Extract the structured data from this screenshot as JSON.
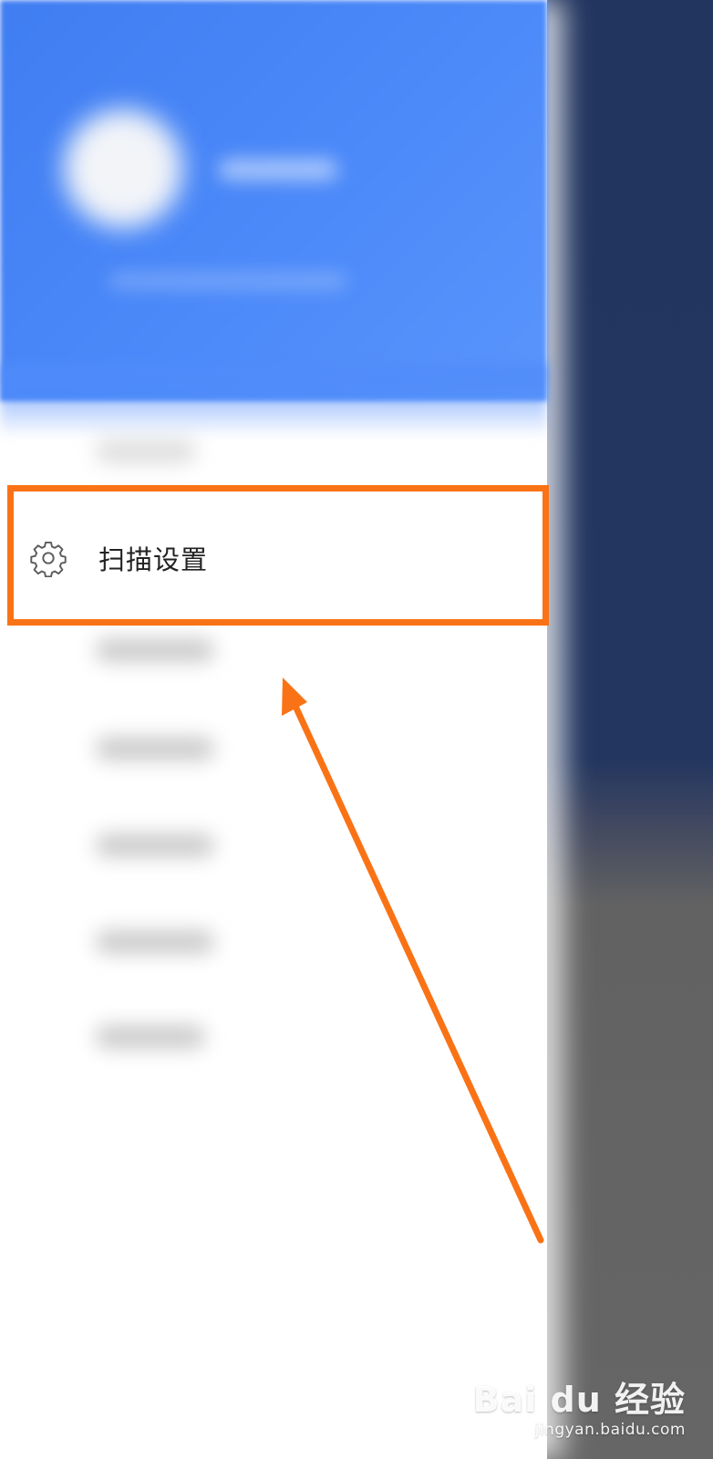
{
  "drawer": {
    "items": [
      {
        "label": "扫描设置",
        "icon": "gear-icon"
      }
    ]
  },
  "annotation": {
    "box_color": "#f97316",
    "arrow_color": "#f97316"
  },
  "watermark": {
    "logo_text": "Bai du 经验",
    "url": "jingyan.baidu.com"
  },
  "colors": {
    "header_blue": "#4d8bfa",
    "backdrop_navy": "#22355f",
    "backdrop_gray": "#666666"
  }
}
